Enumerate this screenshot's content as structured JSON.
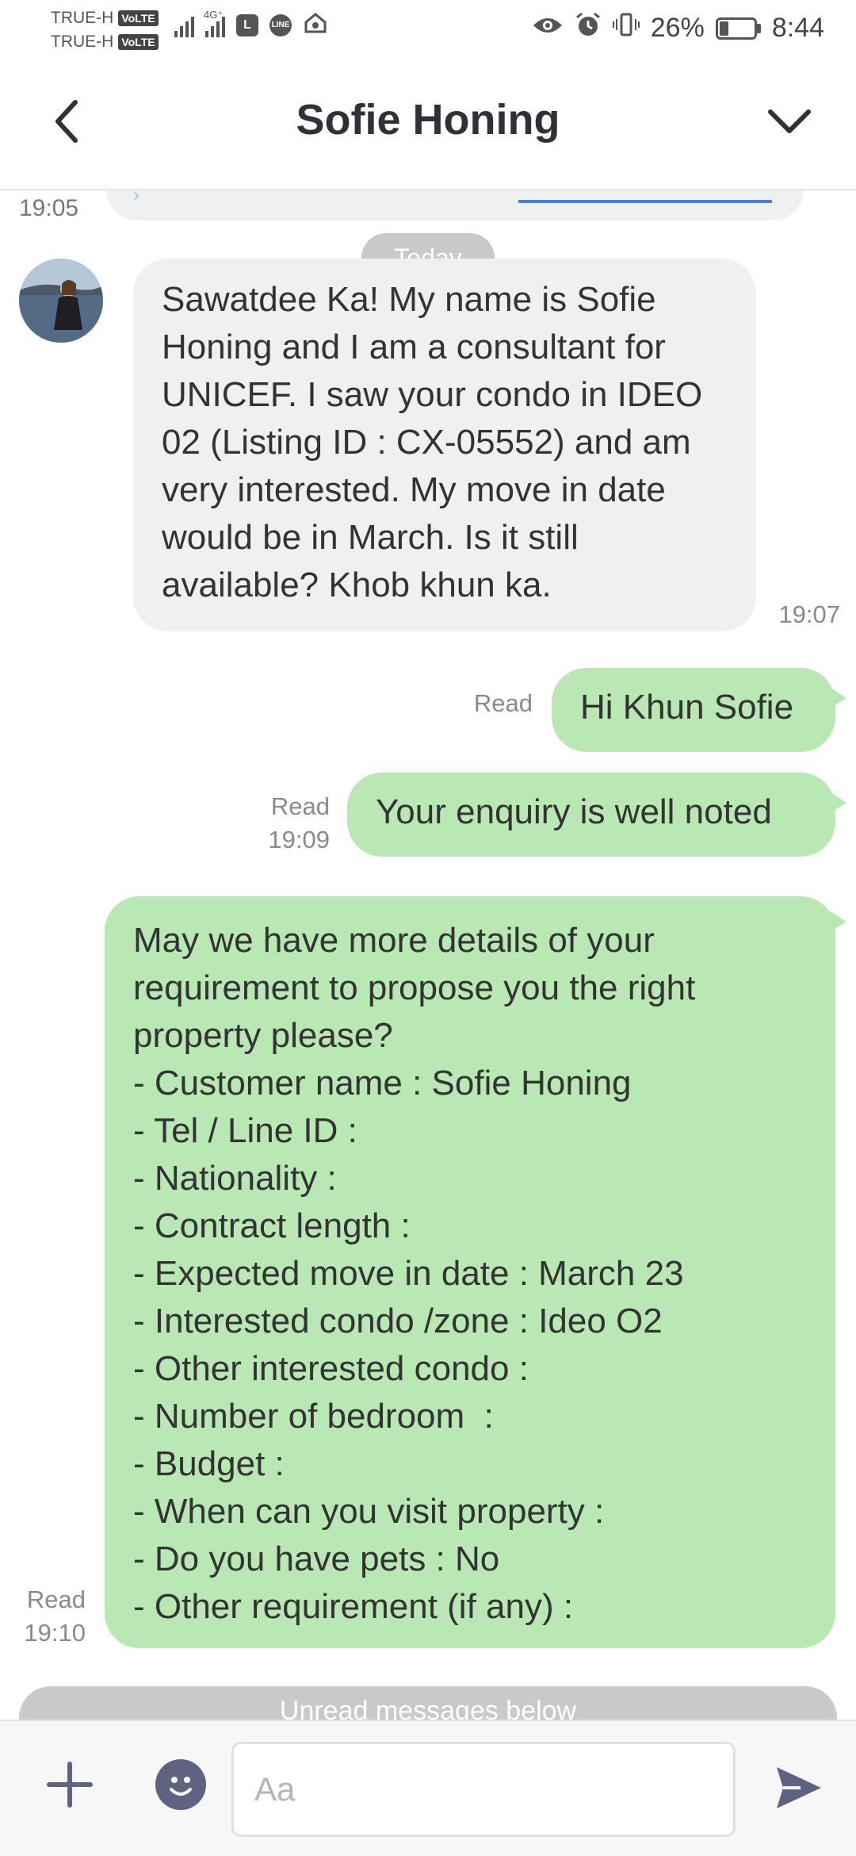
{
  "status_bar": {
    "carrier_1": "TRUE-H",
    "carrier_2": "TRUE-H",
    "volte_badge": "VoLTE",
    "network_type": "4G⁺",
    "battery_percent": "26%",
    "battery_level": 0.26,
    "time": "8:44",
    "icons": [
      "signal-icon",
      "signal-4g-icon",
      "l-app-icon",
      "line-app-icon",
      "cloud-icon",
      "eye-icon",
      "alarm-icon",
      "vibrate-icon",
      "battery-icon"
    ]
  },
  "header": {
    "title": "Sofie Honing",
    "back_icon": "chevron-left-icon",
    "menu_icon": "chevron-down-icon"
  },
  "chat": {
    "previous_time": "19:05",
    "date_separator": "Today",
    "messages": [
      {
        "direction": "incoming",
        "text": "Sawatdee Ka! My name is Sofie Honing and I am a consultant for UNICEF. I saw your condo in IDEO 02 (Listing ID : CX-05552) and am very interested. My move in date would be in March. Is it still available? Khob khun ka.",
        "time": "19:07"
      },
      {
        "direction": "outgoing",
        "text": "Hi Khun Sofie",
        "status": "Read",
        "time": ""
      },
      {
        "direction": "outgoing",
        "text": "Your enquiry is well noted",
        "status": "Read",
        "time": "19:09"
      },
      {
        "direction": "outgoing",
        "lines": [
          "May we have more details of your",
          "requirement to propose you the right",
          "property please?",
          "- Customer name : Sofie Honing",
          "- Tel / Line ID :",
          "- Nationality :",
          "- Contract length :",
          "- Expected move in date : March 23",
          "- Interested condo /zone : Ideo O2",
          "- Other interested condo :",
          "- Number of bedroom  :",
          "- Budget :",
          "- When can you visit property :",
          "- Do you have pets : No",
          "- Other requirement (if any) :"
        ],
        "status": "Read",
        "time": "19:10"
      }
    ],
    "unread_banner": "Unread messages below"
  },
  "input_bar": {
    "placeholder": "Aa",
    "value": ""
  }
}
